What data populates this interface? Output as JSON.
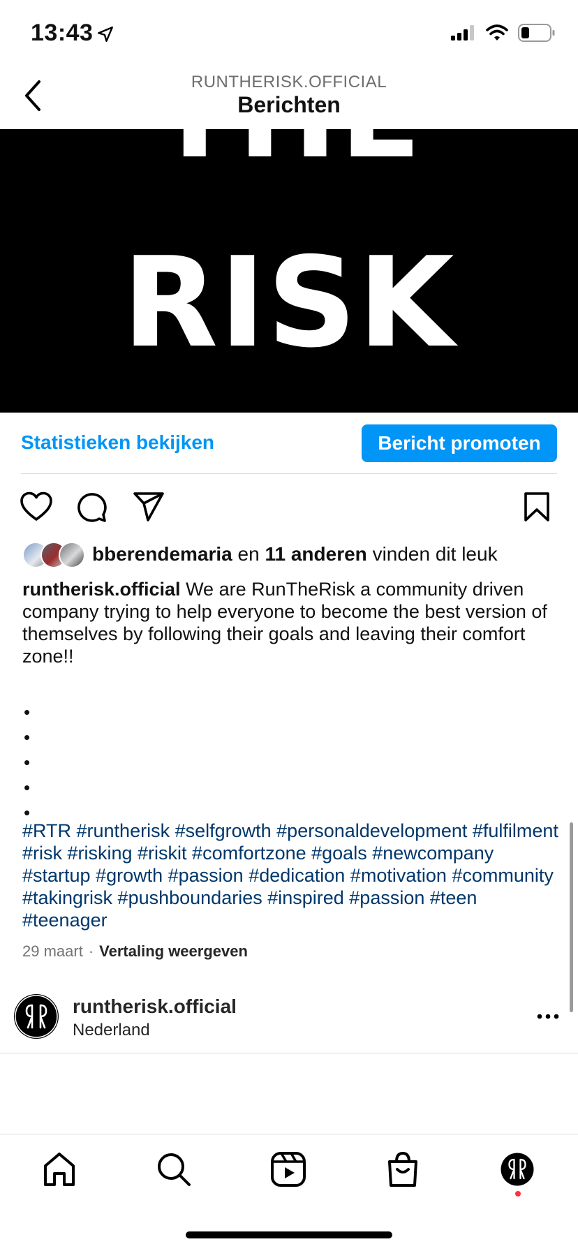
{
  "status_bar": {
    "time": "13:43"
  },
  "header": {
    "account": "RUNTHERISK.OFFICIAL",
    "title": "Berichten"
  },
  "post_image": {
    "line1": "THE",
    "line2": "RISK"
  },
  "insights": {
    "view_label": "Statistieken bekijken",
    "promote_label": "Bericht promoten"
  },
  "likes": {
    "user": "bberendemaria",
    "connector": "en",
    "others": "11 anderen",
    "suffix": "vinden dit leuk"
  },
  "caption": {
    "username": "runtherisk.official",
    "text": "We are RunTheRisk a community driven company trying to help everyone to become the best version of themselves by following their goals and leaving their comfort zone!!",
    "dots": [
      "•",
      "•",
      "•",
      "•",
      "•"
    ],
    "hashtags": "#RTR #runtherisk #selfgrowth #personaldevelopment #fulfilment #risk #risking #riskit #comfortzone #goals #newcompany #startup #growth #passion #dedication #motivation #community #takingrisk #pushboundaries #inspired #passion #teen #teenager"
  },
  "meta": {
    "date": "29 maart",
    "separator": "·",
    "translate_label": "Vertaling weergeven"
  },
  "account_row": {
    "name": "runtherisk.official",
    "location": "Nederland"
  },
  "colors": {
    "accent": "#0095f6",
    "hashtag": "#00376b",
    "notification": "#ff3040"
  },
  "icons": {
    "actions": [
      "heart-icon",
      "comment-icon",
      "share-icon",
      "bookmark-icon"
    ],
    "tabs": [
      "home-icon",
      "search-icon",
      "reels-icon",
      "shop-icon",
      "profile-avatar"
    ]
  }
}
